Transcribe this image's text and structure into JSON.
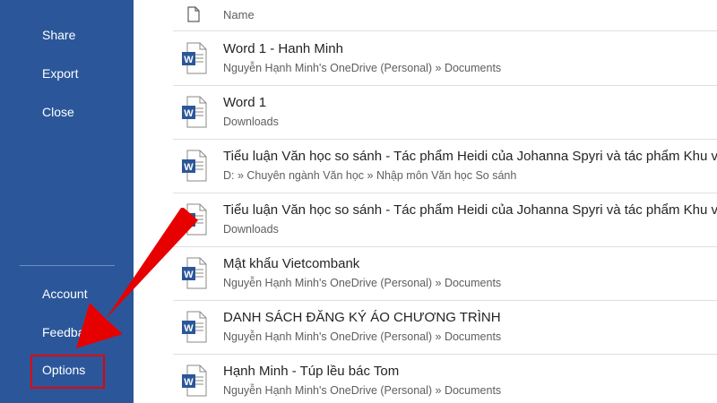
{
  "sidebar": {
    "items_top": [
      "Share",
      "Export",
      "Close"
    ],
    "items_bottom": [
      "Account",
      "Feedback",
      "Options"
    ]
  },
  "file_list": {
    "header": {
      "name_label": "Name",
      "icon": "document-icon"
    },
    "files": [
      {
        "name": "Word 1 - Hanh Minh",
        "path": "Nguyễn Hạnh Minh's OneDrive (Personal) » Documents",
        "icon": "word-icon"
      },
      {
        "name": "Word 1",
        "path": "Downloads",
        "icon": "word-icon"
      },
      {
        "name": "Tiểu luận Văn học so sánh - Tác phẩm Heidi của Johanna Spyri và tác phẩm Khu vườn",
        "path": "D: » Chuyên ngành Văn học » Nhập môn Văn học So sánh",
        "icon": "word-icon"
      },
      {
        "name": "Tiểu luận Văn học so sánh - Tác phẩm Heidi của Johanna Spyri và tác phẩm Khu vườn",
        "path": "Downloads",
        "icon": "word-icon"
      },
      {
        "name": "Mật khẩu Vietcombank",
        "path": "Nguyễn Hạnh Minh's OneDrive (Personal) » Documents",
        "icon": "word-icon"
      },
      {
        "name": "DANH SÁCH ĐĂNG KÝ ÁO CHƯƠNG TRÌNH",
        "path": "Nguyễn Hạnh Minh's OneDrive (Personal) » Documents",
        "icon": "word-icon"
      },
      {
        "name": "Hạnh Minh - Túp lều bác Tom",
        "path": "Nguyễn Hạnh Minh's OneDrive (Personal) » Documents",
        "icon": "word-icon"
      }
    ]
  },
  "colors": {
    "sidebar_bg": "#2b579a",
    "word_blue": "#2b579a",
    "annotation_red": "#e60000"
  }
}
